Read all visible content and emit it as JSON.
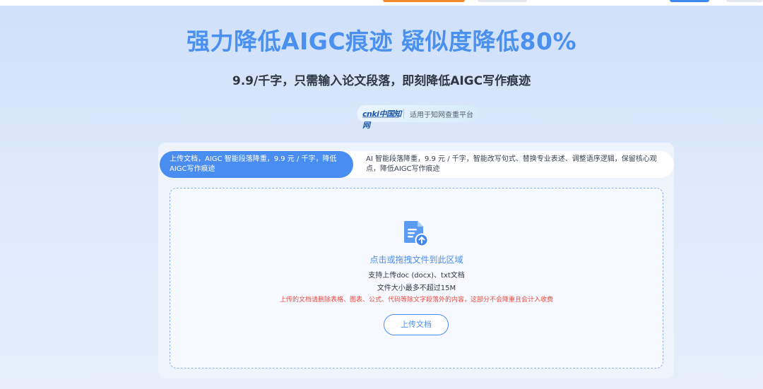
{
  "header": {
    "headline": "强力降低AIGC痕迹 疑似度降低80%",
    "subheadline": "9.9/千字，只需输入论文段落，即刻降低AIGC写作痕迹"
  },
  "platform_badge": {
    "logo_text": "cnki中国知网",
    "label": "适用于知网查重平台"
  },
  "tabs": [
    {
      "label": "上传文档，AIGC 智能段落降重，9.9 元 / 千字，降低AIGC写作痕迹",
      "active": true
    },
    {
      "label": "AI 智能段落降重，9.9 元 / 千字，智能改写句式、替换专业表述、调整语序逻辑，保留核心观点，降低AIGC写作痕迹",
      "active": false
    }
  ],
  "dropzone": {
    "title": "点击或拖拽文件到此区域",
    "support": "支持上传doc (docx)、txt文档",
    "size_limit": "文件大小最多不超过15M",
    "warning": "上传的文档请删除表格、图表、公式、代码等除文字段落外的内容，这部分不会降重且会计入收费",
    "button_label": "上传文档",
    "icon": "document-upload-icon"
  },
  "colors": {
    "accent": "#4a8df0",
    "headline": "#4a90ee",
    "warning": "#ea4a3f",
    "top_orange": "#f28a2e"
  }
}
